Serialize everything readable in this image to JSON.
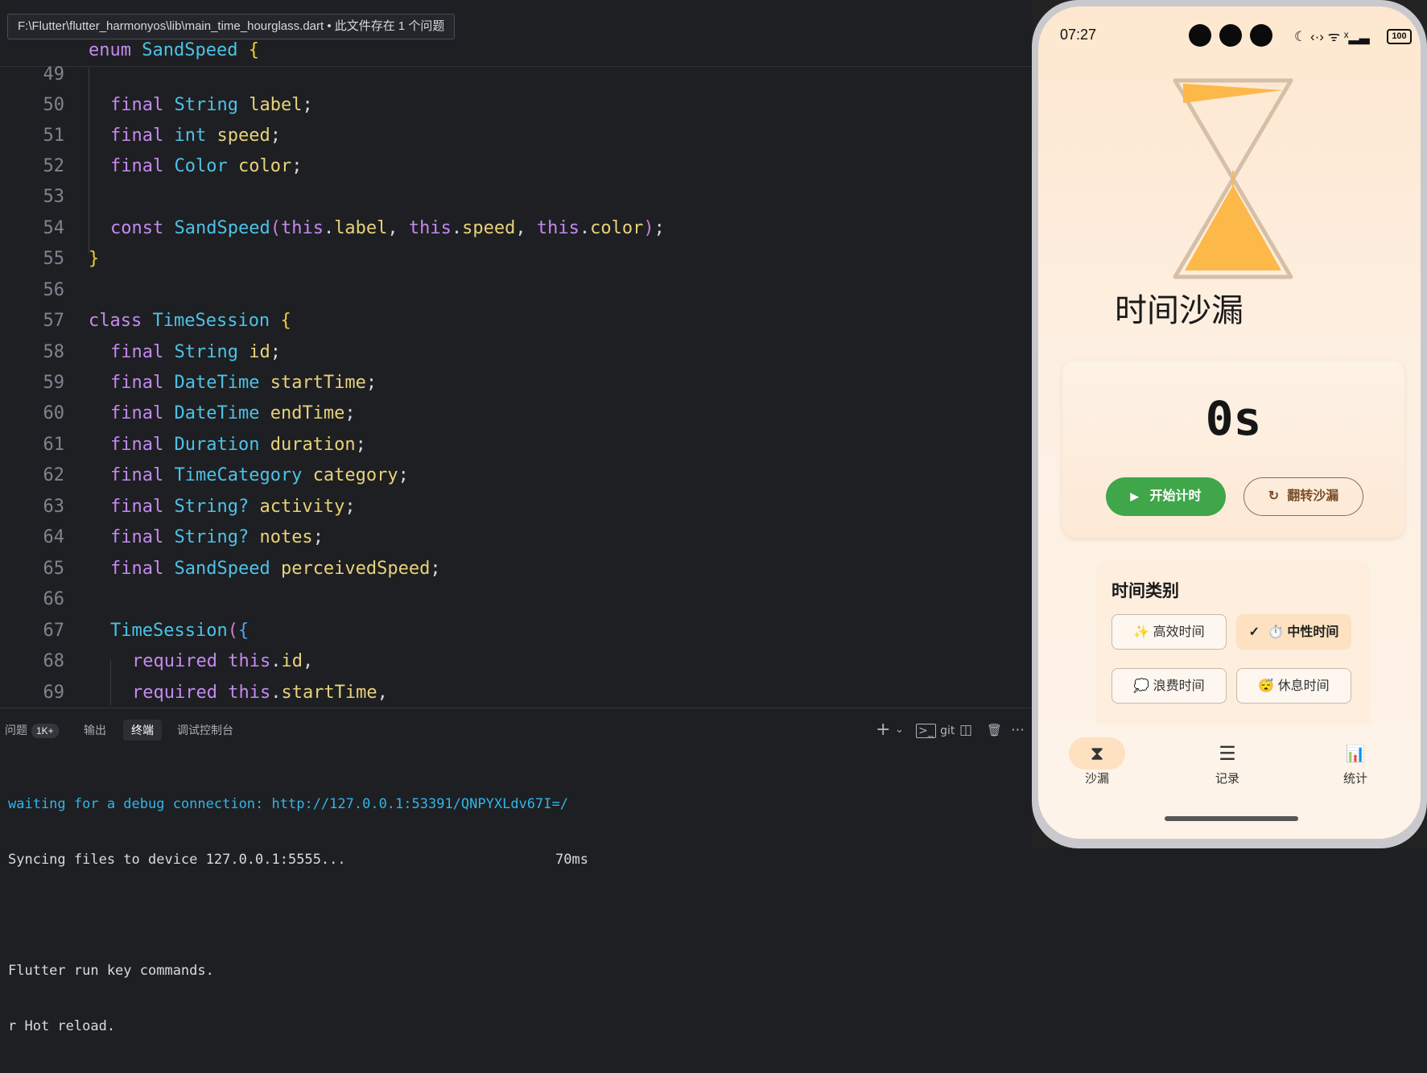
{
  "editor": {
    "tooltip": "F:\\Flutter\\flutter_harmonyos\\lib\\main_time_hourglass.dart • 此文件存在 1 个问题",
    "sticky": {
      "kw": "enum",
      "name": "SandSpeed",
      "brace": "{"
    },
    "line_numbers": [
      "49",
      "50",
      "51",
      "52",
      "53",
      "54",
      "55",
      "56",
      "57",
      "58",
      "59",
      "60",
      "61",
      "62",
      "63",
      "64",
      "65",
      "66",
      "67",
      "68",
      "69"
    ],
    "code": {
      "l50": {
        "kw": "final",
        "ty": "String",
        "id": "label",
        "end": ";"
      },
      "l51": {
        "kw": "final",
        "ty": "int",
        "id": "speed",
        "end": ";"
      },
      "l52": {
        "kw": "final",
        "ty": "Color",
        "id": "color",
        "end": ";"
      },
      "l54": {
        "kw": "const",
        "ty": "SandSpeed",
        "open": "(",
        "this": "this",
        "dot": ".",
        "a1": "label",
        "comma": ", ",
        "a2": "speed",
        "a3": "color",
        "close": ")",
        "end": ";"
      },
      "l55": {
        "brace": "}"
      },
      "l57": {
        "kw": "class",
        "ty": "TimeSession",
        "brace": "{"
      },
      "l58": {
        "kw": "final",
        "ty": "String",
        "id": "id",
        "end": ";"
      },
      "l59": {
        "kw": "final",
        "ty": "DateTime",
        "id": "startTime",
        "end": ";"
      },
      "l60": {
        "kw": "final",
        "ty": "DateTime",
        "id": "endTime",
        "end": ";"
      },
      "l61": {
        "kw": "final",
        "ty": "Duration",
        "id": "duration",
        "end": ";"
      },
      "l62": {
        "kw": "final",
        "ty": "TimeCategory",
        "id": "category",
        "end": ";"
      },
      "l63": {
        "kw": "final",
        "ty": "String?",
        "id": "activity",
        "end": ";"
      },
      "l64": {
        "kw": "final",
        "ty": "String?",
        "id": "notes",
        "end": ";"
      },
      "l65": {
        "kw": "final",
        "ty": "SandSpeed",
        "id": "perceivedSpeed",
        "end": ";"
      },
      "l67": {
        "ty": "TimeSession",
        "open": "(",
        "brace": "{"
      },
      "l68": {
        "kw": "required",
        "this": "this",
        "dot": ".",
        "id": "id",
        "end": ","
      },
      "l69": {
        "kw": "required",
        "this": "this",
        "dot": ".",
        "id": "startTime",
        "end": ","
      }
    }
  },
  "panel": {
    "tabs": {
      "problems": "问题",
      "problems_badge": "1K+",
      "output": "输出",
      "terminal": "终端",
      "debug_console": "调试控制台"
    },
    "actions": {
      "add": "+",
      "dropdown": "⌄",
      "git": "git",
      "split": "◫",
      "trash": "🗑",
      "more": "⋯"
    },
    "terminal": {
      "line1": "waiting for a debug connection: http://127.0.0.1:53391/QNPYXLdv67I=/",
      "line2": "Syncing files to device 127.0.0.1:5555...",
      "line2_time": "70ms",
      "line3": "Flutter run key commands.",
      "line4": "r Hot reload."
    }
  },
  "phone": {
    "status": {
      "time": "07:27",
      "icons": "☾ ‹·› ᯤ ˣ▂▃",
      "battery": "100"
    },
    "app_title": "时间沙漏",
    "timer": {
      "value": "0s",
      "start_label": "开始计时",
      "start_icon": "▶",
      "flip_label": "翻转沙漏",
      "flip_icon": "↻"
    },
    "categories": {
      "title": "时间类别",
      "items": [
        {
          "emoji": "✨",
          "label": "高效时间"
        },
        {
          "check": "✓",
          "emoji": "⏱️",
          "label": "中性时间"
        },
        {
          "emoji": "💭",
          "label": "浪费时间"
        },
        {
          "emoji": "😴",
          "label": "休息时间"
        }
      ]
    },
    "nav": [
      {
        "icon": "⧗",
        "label": "沙漏"
      },
      {
        "icon": "☰",
        "label": "记录"
      },
      {
        "icon": "📊",
        "label": "统计"
      }
    ],
    "colors": {
      "accent_green": "#3fa64a",
      "sand": "#fdb84a",
      "selected_chip": "#fde1c0"
    }
  }
}
